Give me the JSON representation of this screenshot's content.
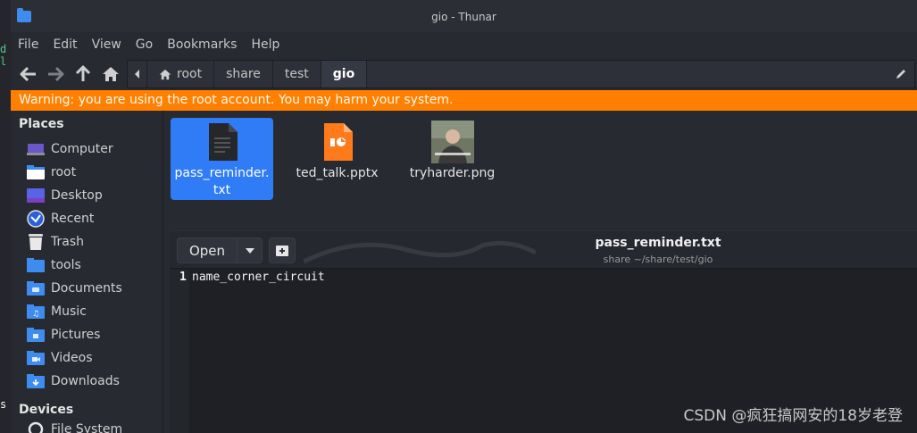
{
  "window": {
    "title": "gio - Thunar"
  },
  "menu": [
    "File",
    "Edit",
    "View",
    "Go",
    "Bookmarks",
    "Help"
  ],
  "path": [
    "root",
    "share",
    "test",
    "gio"
  ],
  "warning": "Warning: you are using the root account. You may harm your system.",
  "sidebar": {
    "places_heading": "Places",
    "items": [
      {
        "label": "Computer",
        "icon": "computer-icon"
      },
      {
        "label": "root",
        "icon": "home-folder-icon"
      },
      {
        "label": "Desktop",
        "icon": "desktop-icon"
      },
      {
        "label": "Recent",
        "icon": "recent-icon"
      },
      {
        "label": "Trash",
        "icon": "trash-icon"
      },
      {
        "label": "tools",
        "icon": "folder-icon"
      },
      {
        "label": "Documents",
        "icon": "documents-folder-icon"
      },
      {
        "label": "Music",
        "icon": "music-folder-icon"
      },
      {
        "label": "Pictures",
        "icon": "pictures-folder-icon"
      },
      {
        "label": "Videos",
        "icon": "videos-folder-icon"
      },
      {
        "label": "Downloads",
        "icon": "downloads-folder-icon"
      }
    ],
    "devices_heading": "Devices",
    "devices": [
      {
        "label": "File System",
        "icon": "drive-icon"
      }
    ]
  },
  "files": [
    {
      "name": "pass_reminder.txt",
      "icon": "text-file-icon",
      "selected": true
    },
    {
      "name": "ted_talk.pptx",
      "icon": "presentation-file-icon",
      "selected": false
    },
    {
      "name": "tryharder.png",
      "icon": "image-thumbnail",
      "selected": false
    }
  ],
  "preview": {
    "open_label": "Open",
    "doc_title": "pass_reminder.txt",
    "doc_subtitle": "share ~/share/test/gio",
    "line_number": "1",
    "line_text": "name_corner_circuit"
  },
  "watermark": "CSDN @疯狂搞网安的18岁老登",
  "colors": {
    "accent": "#2f7cf6",
    "warning": "#ff8000",
    "folder": "#3f8cf0"
  }
}
